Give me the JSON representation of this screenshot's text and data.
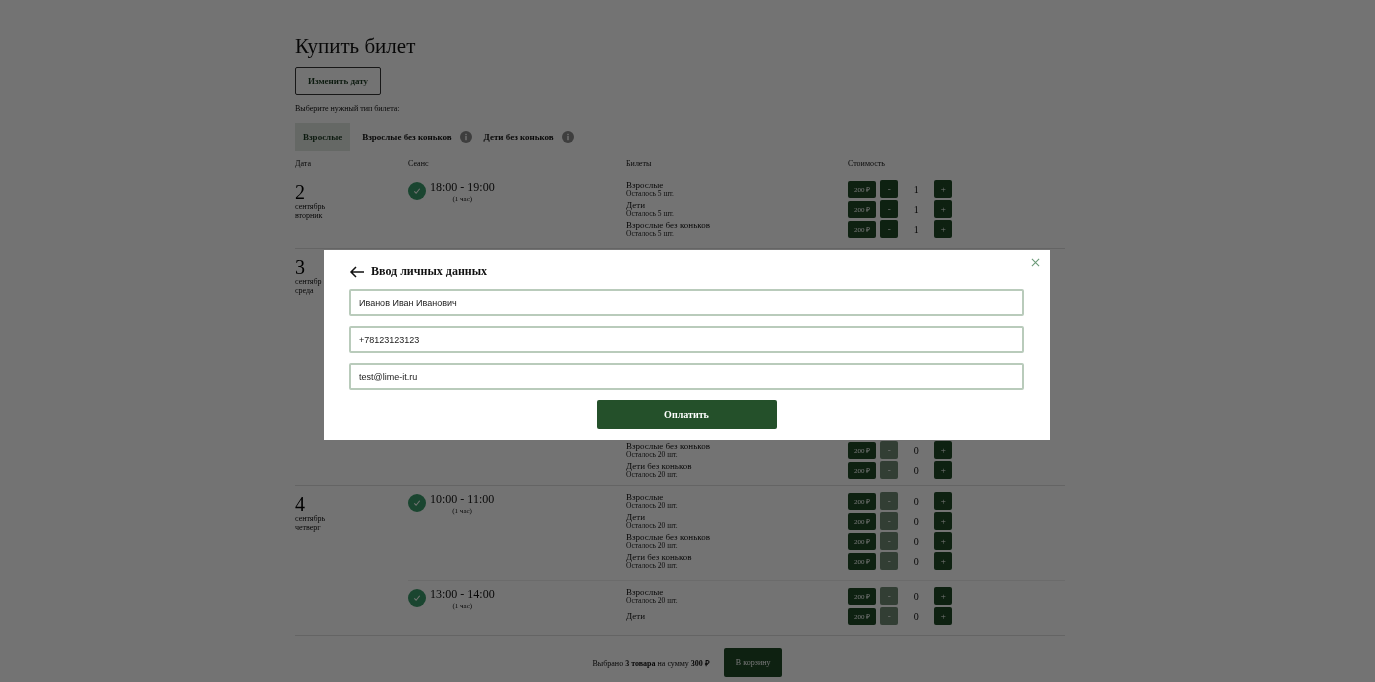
{
  "page": {
    "title": "Купить билет",
    "change_date_button": "Изменить дату",
    "ticket_type_prompt": "Выберите нужный тип билета:",
    "ticket_type_tabs": [
      {
        "label": "Взрослые",
        "selected": true,
        "info": false
      },
      {
        "label": "Взрослые без коньков",
        "selected": false,
        "info": true
      },
      {
        "label": "Дети без коньков",
        "selected": false,
        "info": true
      }
    ],
    "table": {
      "columns": [
        "Дата",
        "Сеанс",
        "Билеты",
        "Стоимость"
      ],
      "days": [
        {
          "day": "2",
          "month": "сентябрь",
          "weekday": "вторник",
          "sessions": [
            {
              "time": "18:00 - 19:00",
              "duration": "(1 час)",
              "tickets": [
                {
                  "name": "Взрослые",
                  "remaining": "Осталось 5 шт.",
                  "price": "200 ₽",
                  "count": "1",
                  "minus_disabled": false
                },
                {
                  "name": "Дети",
                  "remaining": "Осталось 5 шт.",
                  "price": "200 ₽",
                  "count": "1",
                  "minus_disabled": false
                },
                {
                  "name": "Взрослые без коньков",
                  "remaining": "Осталось 5 шт.",
                  "price": "200 ₽",
                  "count": "1",
                  "minus_disabled": false
                }
              ]
            }
          ]
        },
        {
          "day": "3",
          "month": "сентябр",
          "weekday": "среда",
          "sessions": [
            {
              "tickets": [
                {
                  "name": "Взрослые без коньков",
                  "remaining": "Осталось 20 шт.",
                  "price": "200 ₽",
                  "count": "0",
                  "minus_disabled": true
                },
                {
                  "name": "Дети без коньков",
                  "remaining": "Осталось 20 шт.",
                  "price": "200 ₽",
                  "count": "0",
                  "minus_disabled": true
                }
              ]
            }
          ]
        },
        {
          "day": "4",
          "month": "сентябрь",
          "weekday": "четверг",
          "sessions": [
            {
              "time": "10:00 - 11:00",
              "duration": "(1 час)",
              "tickets": [
                {
                  "name": "Взрослые",
                  "remaining": "Осталось 20 шт.",
                  "price": "200 ₽",
                  "count": "0",
                  "minus_disabled": true
                },
                {
                  "name": "Дети",
                  "remaining": "Осталось 20 шт.",
                  "price": "200 ₽",
                  "count": "0",
                  "minus_disabled": true
                },
                {
                  "name": "Взрослые без коньков",
                  "remaining": "Осталось 20 шт.",
                  "price": "200 ₽",
                  "count": "0",
                  "minus_disabled": true
                },
                {
                  "name": "Дети без коньков",
                  "remaining": "Осталось 20 шт.",
                  "price": "200 ₽",
                  "count": "0",
                  "minus_disabled": true
                }
              ]
            },
            {
              "time": "13:00 - 14:00",
              "duration": "(1 час)",
              "tickets": [
                {
                  "name": "Взрослые",
                  "remaining": "Осталось 20 шт.",
                  "price": "200 ₽",
                  "count": "0",
                  "minus_disabled": true
                },
                {
                  "name": "Дети",
                  "price": "200 ₽",
                  "count": "0",
                  "minus_disabled": true
                }
              ]
            }
          ]
        }
      ]
    },
    "stepper_labels": {
      "minus": "-",
      "plus": "+"
    },
    "footer": {
      "summary": "Выбрано **3 товара** на сумму **300  ₽**",
      "cart_button": "В корзину"
    }
  },
  "modal": {
    "title": "Ввод личных данных",
    "fields": [
      {
        "value": "Иванов Иван Иванович"
      },
      {
        "value": "+78123123123"
      },
      {
        "value": "test@lime-it.ru"
      }
    ],
    "pay_button": "Оплатить"
  }
}
